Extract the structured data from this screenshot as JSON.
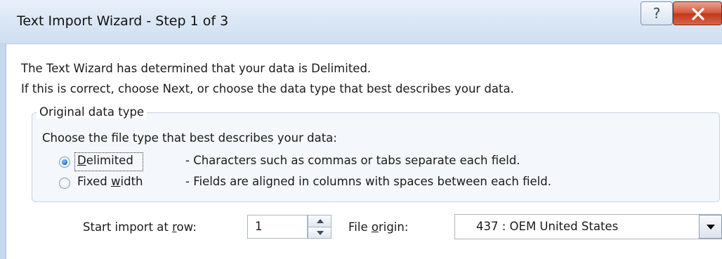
{
  "window": {
    "title": "Text Import Wizard - Step 1 of 3",
    "help_glyph": "?",
    "close_glyph": "X",
    "icons": [
      "help-icon",
      "close-icon"
    ]
  },
  "intro": {
    "line1": "The Text Wizard has determined that your data is Delimited.",
    "line2": "If this is correct, choose Next, or choose the data type that best describes your data."
  },
  "group": {
    "legend": "Original data type",
    "prompt": "Choose the file type that best describes your data:",
    "options": [
      {
        "label_pre": "",
        "label_accel": "D",
        "label_post": "elimited",
        "description": "- Characters such as commas or tabs separate each field.",
        "checked": true
      },
      {
        "label_pre": "Fixed ",
        "label_accel": "w",
        "label_post": "idth",
        "description": "- Fields are aligned in columns with spaces between each field.",
        "checked": false
      }
    ]
  },
  "start_row": {
    "label_pre": "Start import at ",
    "label_accel": "r",
    "label_post": "ow:",
    "value": "1"
  },
  "file_origin": {
    "label_pre": "File ",
    "label_accel": "o",
    "label_post": "rigin:",
    "value": "437 : OEM United States"
  },
  "colors": {
    "titlebar": "#dbe7f5",
    "close_button": "#c2371a",
    "groupbox_fill": "#f4f7fb",
    "radio_checked": "#1f7fd6"
  }
}
